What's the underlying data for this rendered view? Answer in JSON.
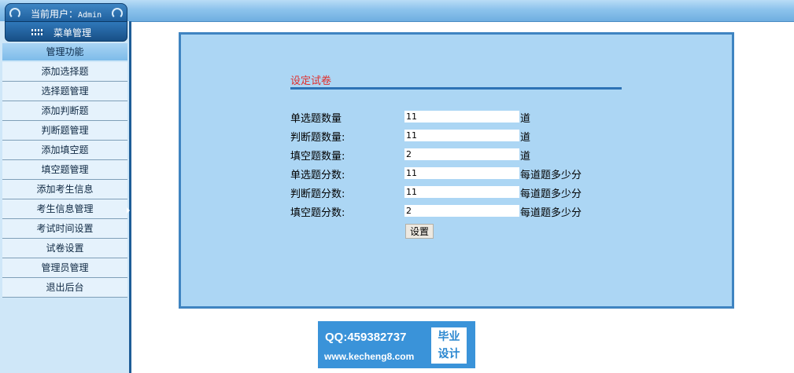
{
  "header": {
    "user_prefix": "当前用户：",
    "user_name": "Admin"
  },
  "sidebar": {
    "menu_title": "菜单管理",
    "section_title": "管理功能",
    "items": [
      {
        "label": "添加选择题"
      },
      {
        "label": "选择题管理"
      },
      {
        "label": "添加判断题"
      },
      {
        "label": "判断题管理"
      },
      {
        "label": "添加填空题"
      },
      {
        "label": "填空题管理"
      },
      {
        "label": "添加考生信息"
      },
      {
        "label": "考生信息管理"
      },
      {
        "label": "考试时间设置"
      },
      {
        "label": "试卷设置"
      },
      {
        "label": "管理员管理"
      },
      {
        "label": "退出后台"
      }
    ]
  },
  "form": {
    "title": "设定试卷",
    "rows": [
      {
        "label": "单选题数量",
        "value": "11",
        "unit": "道"
      },
      {
        "label": "判断题数量:",
        "value": "11",
        "unit": "道"
      },
      {
        "label": "填空题数量:",
        "value": "2",
        "unit": "道"
      },
      {
        "label": "单选题分数:",
        "value": "11",
        "unit": "每道题多少分"
      },
      {
        "label": "判断题分数:",
        "value": "11",
        "unit": "每道题多少分"
      },
      {
        "label": "填空题分数:",
        "value": "2",
        "unit": "每道题多少分"
      }
    ],
    "submit_label": "设置"
  },
  "watermark": {
    "qq": "QQ:459382737",
    "site": "www.kecheng8.com",
    "tag_line1": "毕业",
    "tag_line2": "设计"
  },
  "colors": {
    "panel_bg": "#acd6f4",
    "panel_border": "#3f84c1",
    "title_red": "#e0302e",
    "sidebar_bg": "#cfe7f8"
  }
}
